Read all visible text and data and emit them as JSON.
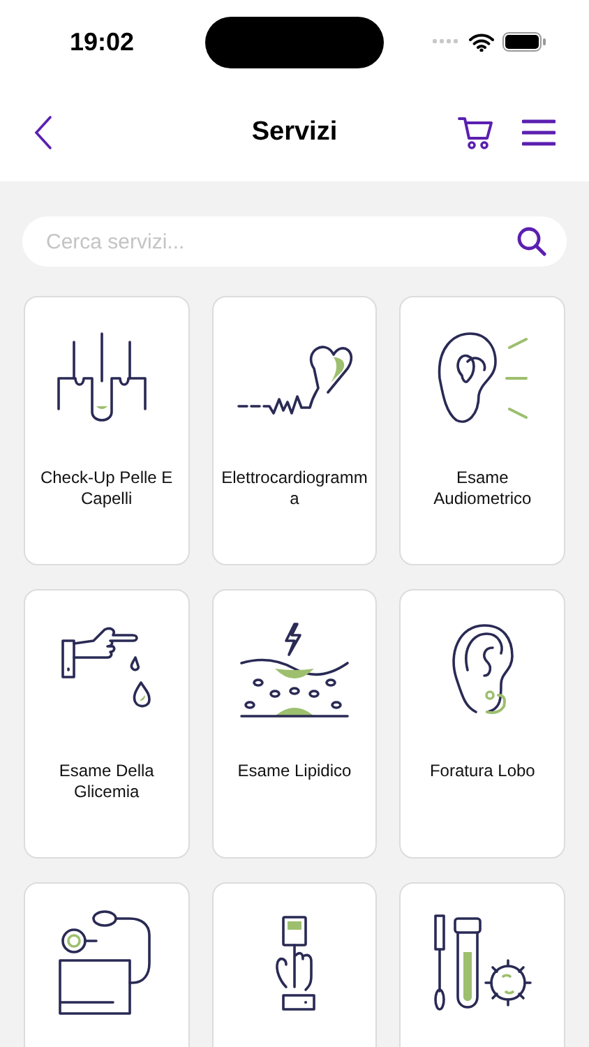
{
  "status_bar": {
    "time": "19:02"
  },
  "header": {
    "title": "Servizi"
  },
  "search": {
    "placeholder": "Cerca servizi..."
  },
  "services": [
    {
      "kind": "hair",
      "label": "Check-Up Pelle E Capelli"
    },
    {
      "kind": "ecg",
      "label": "Elettrocardiogramma"
    },
    {
      "kind": "ear-sound",
      "label": "Esame Audiometrico"
    },
    {
      "kind": "blood-drop",
      "label": "Esame Della Glicemia"
    },
    {
      "kind": "lipid",
      "label": "Esame Lipidico"
    },
    {
      "kind": "earring",
      "label": "Foratura Lobo"
    },
    {
      "kind": "pressure"
    },
    {
      "kind": "oximeter"
    },
    {
      "kind": "swab"
    }
  ]
}
